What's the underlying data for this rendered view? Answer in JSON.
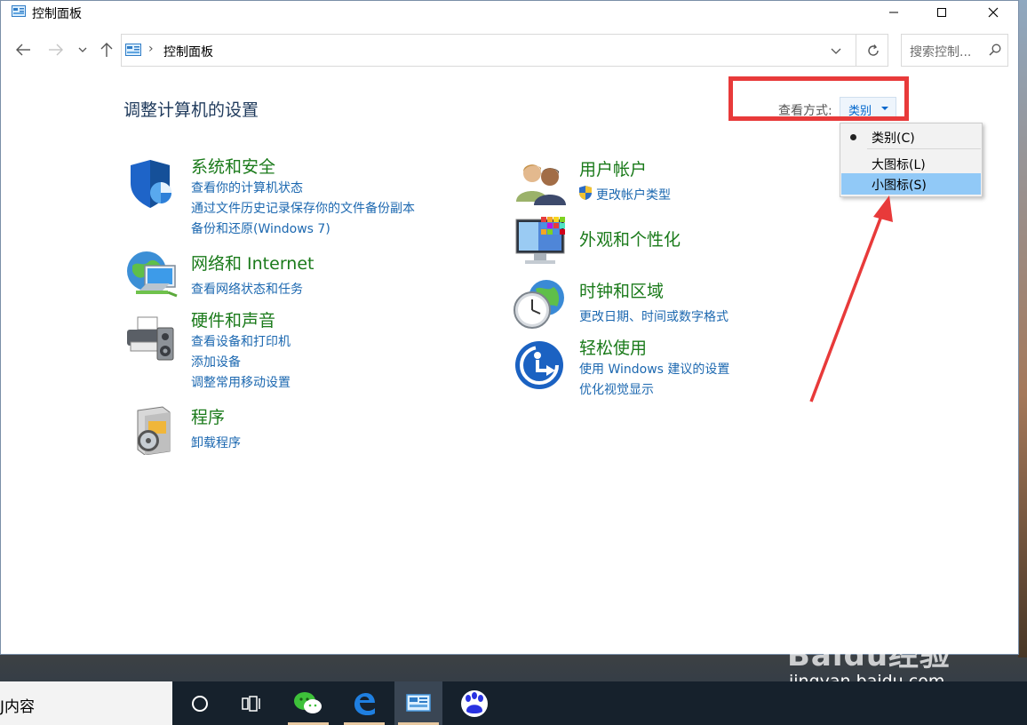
{
  "window": {
    "title": "控制面板"
  },
  "address": {
    "path": "控制面板",
    "separator": "›"
  },
  "search": {
    "placeholder": "搜索控制..."
  },
  "heading": "调整计算机的设置",
  "view_by": {
    "label": "查看方式:",
    "value": "类别"
  },
  "menu": {
    "items": [
      {
        "label": "类别(C)",
        "checked": true
      },
      {
        "label": "大图标(L)"
      },
      {
        "label": "小图标(S)",
        "highlighted": true
      }
    ]
  },
  "categories": {
    "system": {
      "title": "系统和安全",
      "links": [
        "查看你的计算机状态",
        "通过文件历史记录保存你的文件备份副本",
        "备份和还原(Windows 7)"
      ]
    },
    "network": {
      "title": "网络和 Internet",
      "links": [
        "查看网络状态和任务"
      ]
    },
    "hardware": {
      "title": "硬件和声音",
      "links": [
        "查看设备和打印机",
        "添加设备",
        "调整常用移动设置"
      ]
    },
    "programs": {
      "title": "程序",
      "links": [
        "卸载程序"
      ]
    },
    "users": {
      "title": "用户帐户",
      "links": [
        "更改帐户类型"
      ]
    },
    "appearance": {
      "title": "外观和个性化",
      "links": []
    },
    "clock": {
      "title": "时钟和区域",
      "links": [
        "更改日期、时间或数字格式"
      ]
    },
    "ease": {
      "title": "轻松使用",
      "links": [
        "使用 Windows 建议的设置",
        "优化视觉显示"
      ]
    }
  },
  "taskbar": {
    "search_text": "J内容"
  },
  "watermark": {
    "brand": "Baidu经验",
    "url": "jingyan.baidu.com"
  },
  "colors": {
    "accent_link": "#1c68b0",
    "category_title": "#1a7a1a",
    "heading": "#1e395b",
    "annotation": "#e83a3a",
    "menu_highlight": "#91c9f7"
  }
}
